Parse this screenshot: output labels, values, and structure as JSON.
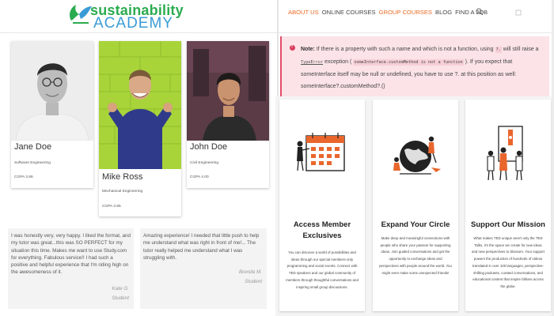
{
  "brand": {
    "logo_line1": "sustainability",
    "logo_line2": "ACADEMY",
    "logo_mark_text": "SA"
  },
  "nav": {
    "items": [
      "About Us",
      "Online Courses",
      "Group Courses",
      "Blog",
      "Find a Job"
    ],
    "active_items": [
      0,
      2
    ],
    "accent_color": "#ea6b25"
  },
  "students": [
    {
      "name": "Jane Doe",
      "major": "Software Engineering",
      "gpa": "CGPA 3.86"
    },
    {
      "name": "Mike Ross",
      "major": "Mechanical Engineering",
      "gpa": "CGPA 3.85"
    },
    {
      "name": "John Doe",
      "major": "Civil Engineering",
      "gpa": "CGPA 4.00"
    }
  ],
  "testimonials": [
    {
      "text": "I was honestly very, very happy. I liked the format, and my tutor was great...this was SO PERFECT for my situation this time. Makes me want to use Study.com for everything. Fabulous service!! I had such a positive and helpful experience that I'm riding high on the awesomeness of it.",
      "author": "Kate G.",
      "role": "Student"
    },
    {
      "text": "Amazing experience! I needed that little push to help me understand what was right in front of me!... The tutor really helped me understand what I was struggling with.",
      "author": "Brenda M.",
      "role": "Student"
    }
  ],
  "note": {
    "label": "Note:",
    "p1": "If there is a property with such a name and which is not a function, using",
    "p1_code": "?.",
    "p2": "will still raise a",
    "p2_link": "TypeError",
    "p2b": "exception (",
    "p2_code": "someInterface.customMethod is not a function",
    "p3": "). If you expect that someInterface itself may be null or undefined, you have to use ?. at this position as well: someInterface?.customMethod?.()"
  },
  "features": [
    {
      "title": "Access Member Exclusives",
      "icon": "calendar-illustration",
      "desc": "You can discover a world of possibilities and ideas through our special members-only programming and social events. Connect with TED speakers and our global community of members through thoughtful conversations and inspiring small group discussions."
    },
    {
      "title": "Expand Your Circle",
      "icon": "globe-illustration",
      "desc": "Make deep and meaningful connections with people who share your passion for supporting ideas. Join guided conversations and get the opportunity to exchange ideas and perspectives with people around the world. You might even make some unexpected friends!"
    },
    {
      "title": "Support Our Mission",
      "icon": "people-illustration",
      "desc": "What makes TED unique aren't only the TED Talks, it's the space we create for new ideas and new perspectives to blossom. Your support powers the production of hundreds of videos translated in over 100 languages, perspective-shifting podcasts, curated conversations, and educational content that inspire billions across the globe."
    }
  ]
}
